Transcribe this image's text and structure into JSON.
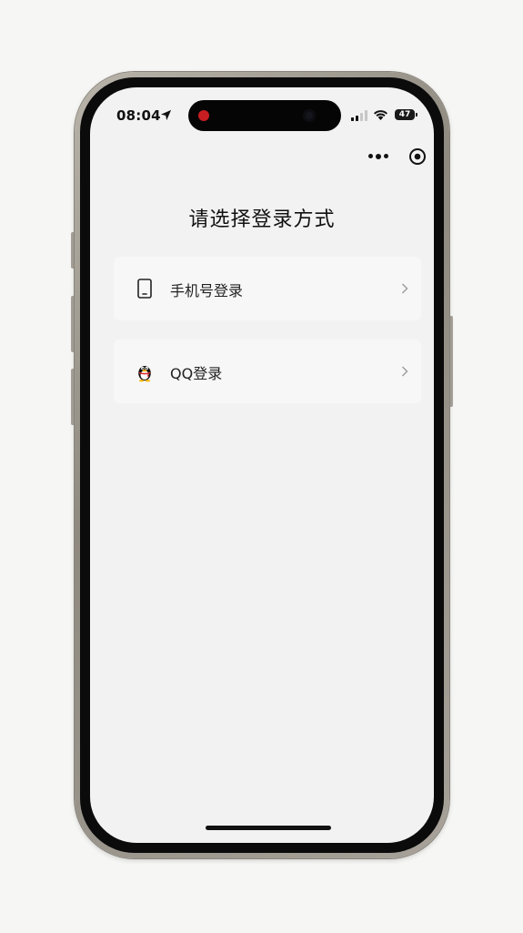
{
  "status_bar": {
    "time": "08:04",
    "battery": "47",
    "icons": [
      "location-arrow-icon",
      "cellular-signal-icon",
      "wifi-icon",
      "battery-icon"
    ]
  },
  "capsule": {
    "icons": [
      "more-dots-icon",
      "close-circle-icon"
    ]
  },
  "page": {
    "title": "请选择登录方式"
  },
  "options": [
    {
      "label": "手机号登录",
      "icon": "mobile-phone-icon"
    },
    {
      "label": "QQ登录",
      "icon": "qq-penguin-icon"
    }
  ],
  "colors": {
    "background": "#f2f2f2",
    "card": "#f7f7f7",
    "text": "#111111",
    "qq_red": "#d9262b",
    "qq_yellow": "#f5b400"
  }
}
